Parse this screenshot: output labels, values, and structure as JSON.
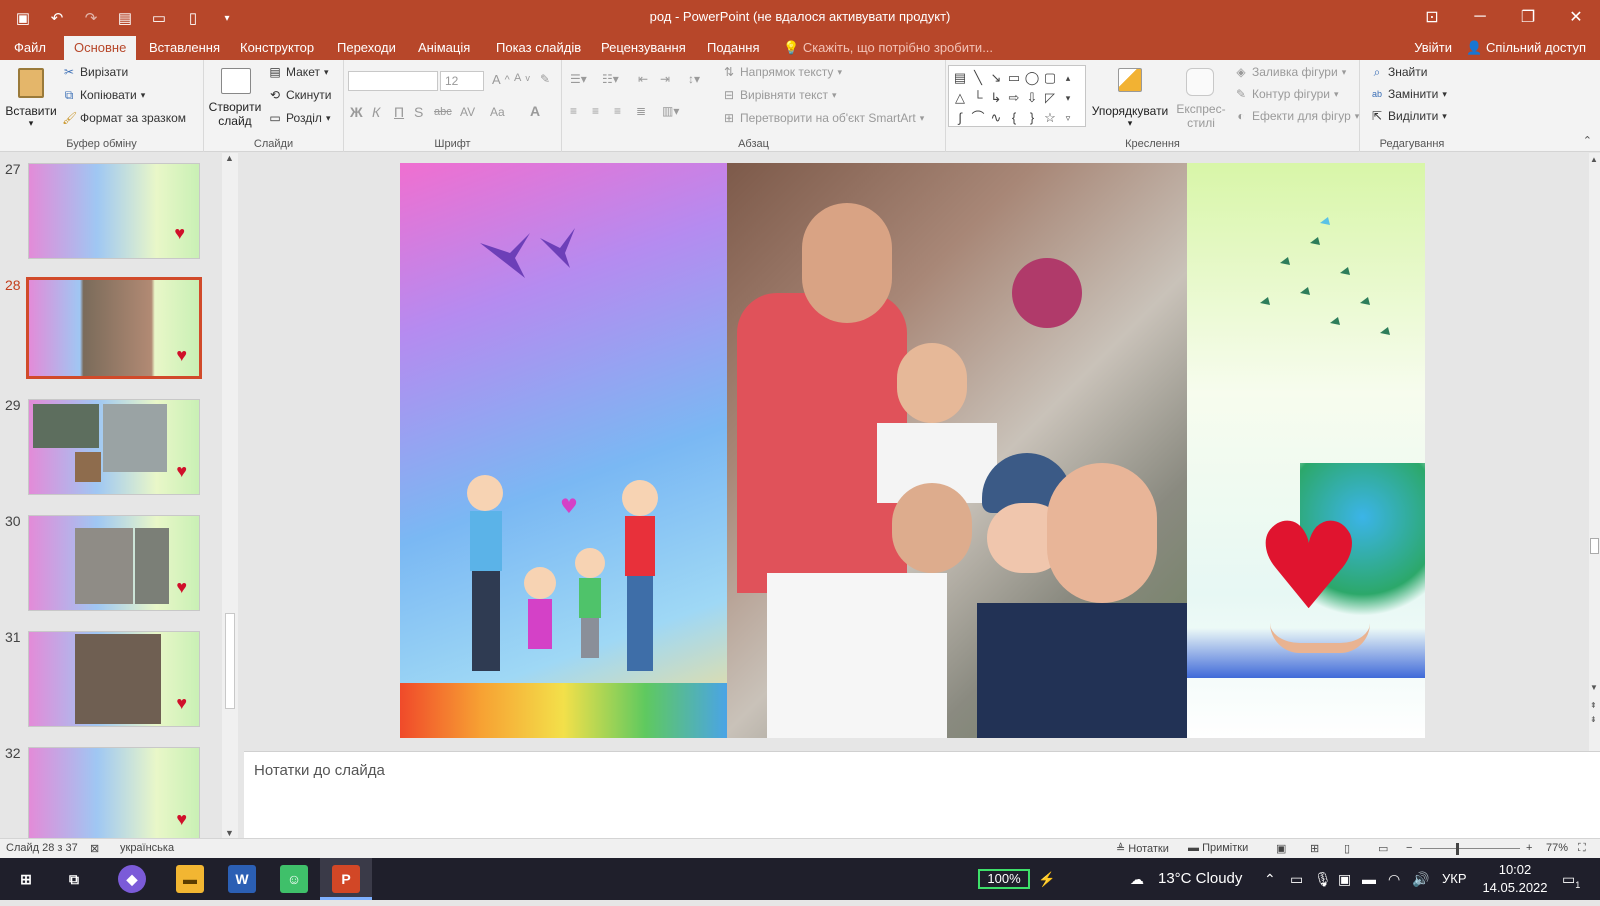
{
  "window": {
    "title": "род - PowerPoint (не вдалося активувати продукт)"
  },
  "qat": {
    "icons": [
      "save-icon",
      "undo-icon",
      "redo-icon",
      "from-beginning-icon",
      "open-icon",
      "new-icon",
      "customize-icon"
    ]
  },
  "tabs": [
    {
      "label": "Файл"
    },
    {
      "label": "Основне"
    },
    {
      "label": "Вставлення"
    },
    {
      "label": "Конструктор"
    },
    {
      "label": "Переходи"
    },
    {
      "label": "Анімація"
    },
    {
      "label": "Показ слайдів"
    },
    {
      "label": "Рецензування"
    },
    {
      "label": "Подання"
    }
  ],
  "active_tab": "Основне",
  "tellme": "Скажіть, що потрібно зробити...",
  "signin": "Увійти",
  "share": "Спільний доступ",
  "ribbon": {
    "clipboard": {
      "paste": "Вставити",
      "cut": "Вирізати",
      "copy": "Копіювати",
      "format_painter": "Формат за зразком",
      "label": "Буфер обміну"
    },
    "slides": {
      "new_slide": "Створити слайд",
      "layout": "Макет",
      "reset": "Скинути",
      "section": "Розділ",
      "label": "Слайди"
    },
    "font": {
      "name": "",
      "size": "12",
      "bold": "Ж",
      "italic": "К",
      "underline": "П",
      "shadow": "S",
      "strike": "abc",
      "spacing": "AV",
      "case": "Aa",
      "color": "A",
      "label": "Шрифт"
    },
    "paragraph": {
      "text_direction": "Напрямок тексту",
      "align_text": "Вирівняти текст",
      "smartart": "Перетворити на об'єкт SmartArt",
      "label": "Абзац"
    },
    "drawing": {
      "arrange": "Упорядкувати",
      "quick_styles": "Експрес-стилі",
      "fill": "Заливка фігури",
      "outline": "Контур фігури",
      "effects": "Ефекти для фігур",
      "label": "Креслення"
    },
    "editing": {
      "find": "Знайти",
      "replace": "Замінити",
      "select": "Виділити",
      "label": "Редагування"
    }
  },
  "thumbnails": [
    {
      "number": "27",
      "selected": false
    },
    {
      "number": "28",
      "selected": true
    },
    {
      "number": "29",
      "selected": false
    },
    {
      "number": "30",
      "selected": false
    },
    {
      "number": "31",
      "selected": false
    },
    {
      "number": "32",
      "selected": false
    }
  ],
  "notes_placeholder": "Нотатки до слайда",
  "status": {
    "slide": "Слайд 28 з 37",
    "language": "українська",
    "notes": "Нотатки",
    "comments": "Примітки",
    "zoom": "77%"
  },
  "taskbar": {
    "battery": "100%",
    "weather": "13°C  Cloudy",
    "lang": "УКР",
    "time": "10:02",
    "date": "14.05.2022",
    "notif_count": "1"
  },
  "colors": {
    "accent": "#b7472a",
    "selection": "#d14a2a"
  }
}
